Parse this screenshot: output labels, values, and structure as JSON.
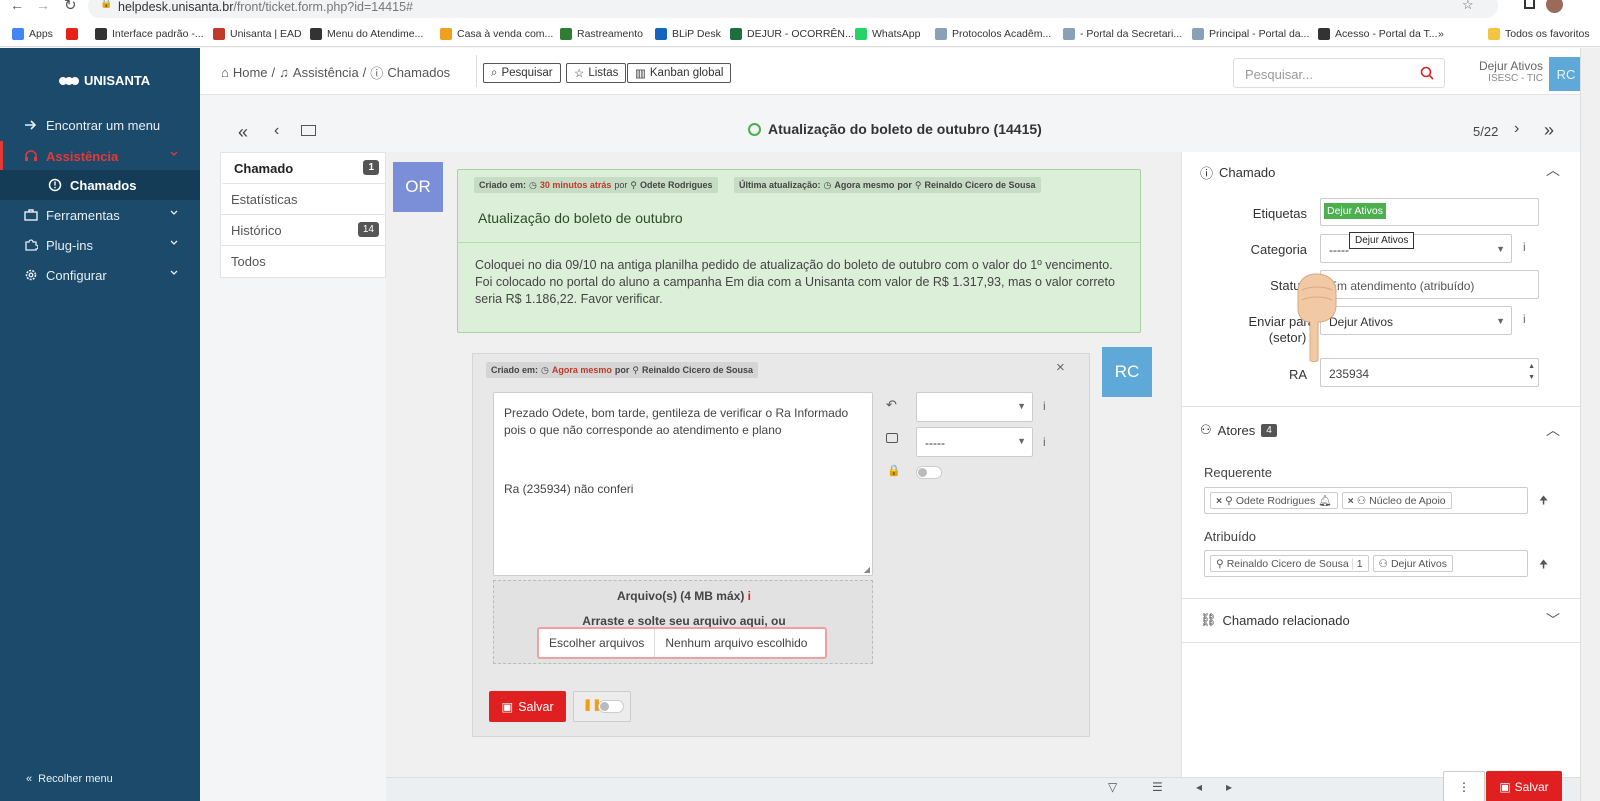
{
  "browser": {
    "url_host": "helpdesk.unisanta.br",
    "url_path": "/front/ticket.form.php?id=14415#",
    "bookmarks": [
      {
        "label": "Apps",
        "color": "#4285f4"
      },
      {
        "label": "",
        "color": "#e62117"
      },
      {
        "label": "Interface padrão -...",
        "color": "#333333"
      },
      {
        "label": "Unisanta | EAD",
        "color": "#c0392b"
      },
      {
        "label": "Menu do Atendime...",
        "color": "#333333"
      },
      {
        "label": "Casa à venda com...",
        "color": "#f0a020"
      },
      {
        "label": "Rastreamento",
        "color": "#2e7d32"
      },
      {
        "label": "BLiP Desk",
        "color": "#1565c0"
      },
      {
        "label": "DEJUR - OCORRÊN...",
        "color": "#1d6f42"
      },
      {
        "label": "WhatsApp",
        "color": "#25d366"
      },
      {
        "label": "Protocolos Acadêm...",
        "color": "#8aa0b8"
      },
      {
        "label": "- Portal da Secretari...",
        "color": "#8aa0b8"
      },
      {
        "label": "Principal - Portal da...",
        "color": "#8aa0b8"
      },
      {
        "label": "Acesso - Portal da T...",
        "color": "#333333"
      }
    ],
    "more_bookmarks": "»",
    "all_favorites": "Todos os favoritos"
  },
  "sidebar": {
    "logo": "UNISANTA",
    "items": [
      {
        "label": "Encontrar um menu",
        "icon": "arrow-right-icon"
      },
      {
        "label": "Assistência",
        "icon": "headset-icon",
        "active": true
      },
      {
        "label": "Chamados",
        "icon": "alert-circle-icon",
        "sub": true
      },
      {
        "label": "Ferramentas",
        "icon": "briefcase-icon"
      },
      {
        "label": "Plug-ins",
        "icon": "puzzle-icon"
      },
      {
        "label": "Configurar",
        "icon": "gear-icon"
      }
    ],
    "collapse": "Recolher menu"
  },
  "header": {
    "breadcrumb": [
      "Home",
      "Assistência",
      "Chamados"
    ],
    "actions": [
      "Pesquisar",
      "Listas",
      "Kanban global"
    ],
    "search_placeholder": "Pesquisar...",
    "user_name": "Dejur Ativos",
    "user_entity": "ISESC - TIC",
    "user_initials": "RC"
  },
  "ticket_nav": {
    "title": "Atualização do boleto de outubro (14415)",
    "pager": "5/22"
  },
  "tabs": [
    {
      "label": "Chamado",
      "count": "1"
    },
    {
      "label": "Estatísticas",
      "count": ""
    },
    {
      "label": "Histórico",
      "count": "14"
    },
    {
      "label": "Todos",
      "count": ""
    }
  ],
  "ticket": {
    "avatar": "OR",
    "created_label": "Criado em:",
    "created_when": "30 minutos atrás",
    "by": "por",
    "author": "Odete Rodrigues",
    "updated_label": "Última atualização:",
    "updated_when": "Agora mesmo",
    "updated_by": "Reinaldo Cicero de Sousa",
    "subject": "Atualização do boleto de outubro",
    "body_lines": [
      "Coloquei no dia 09/10 na antiga planilha pedido de atualização do boleto de outubro com o valor do 1º vencimento.",
      "Foi colocado no portal do aluno a campanha Em dia com a Unisanta com valor de R$ 1.317,93, mas o valor correto",
      "seria R$ 1.186,22. Favor verificar."
    ]
  },
  "reply": {
    "avatar": "RC",
    "created_label": "Criado em:",
    "created_when": "Agora mesmo",
    "by": "por",
    "author": "Reinaldo Cicero de Sousa",
    "text_line1": "Prezado Odete, bom tarde, gentileza de verificar o Ra Informado",
    "text_line2": "pois o que não corresponde ao atendimento e plano",
    "text_line3": "Ra (235934) não conferi",
    "select1_value": "",
    "select2_value": "-----",
    "files_title": "Arquivo(s) (4 MB máx)",
    "files_drop": "Arraste e solte seu arquivo aqui, ou",
    "choose_files": "Escolher arquivos",
    "no_file": "Nenhum arquivo escolhido",
    "save": "Salvar"
  },
  "panel": {
    "chamado_title": "Chamado",
    "labels": {
      "etiquetas": "Etiquetas",
      "categoria": "Categoria",
      "status": "Status",
      "enviar_para_1": "Enviar para",
      "enviar_para_2": "(setor)",
      "ra": "RA"
    },
    "etiqueta_tag": "Dejur Ativos",
    "tooltip": "Dejur Ativos",
    "categoria_value": "-----",
    "status_value": "Em atendimento (atribuído)",
    "enviar_value": "Dejur Ativos",
    "ra_value": "235934",
    "atores_title": "Atores",
    "atores_count": "4",
    "requerente_label": "Requerente",
    "requerentes": [
      "Odete Rodrigues",
      "Núcleo de Apoio"
    ],
    "atribuido_label": "Atribuído",
    "atribuido_person": "Reinaldo Cicero de Sousa",
    "atribuido_person_count": "1",
    "atribuido_group": "Dejur Ativos",
    "relacionado_title": "Chamado relacionado",
    "footer_save": "Salvar"
  },
  "colors": {
    "sidebar": "#1b4a6b",
    "accent_red": "#e02020",
    "avatar_or": "#7b8fd9",
    "avatar_rc": "#5ea9d8",
    "ticket_bg": "#dcefd9",
    "tag_green": "#4caf50"
  }
}
